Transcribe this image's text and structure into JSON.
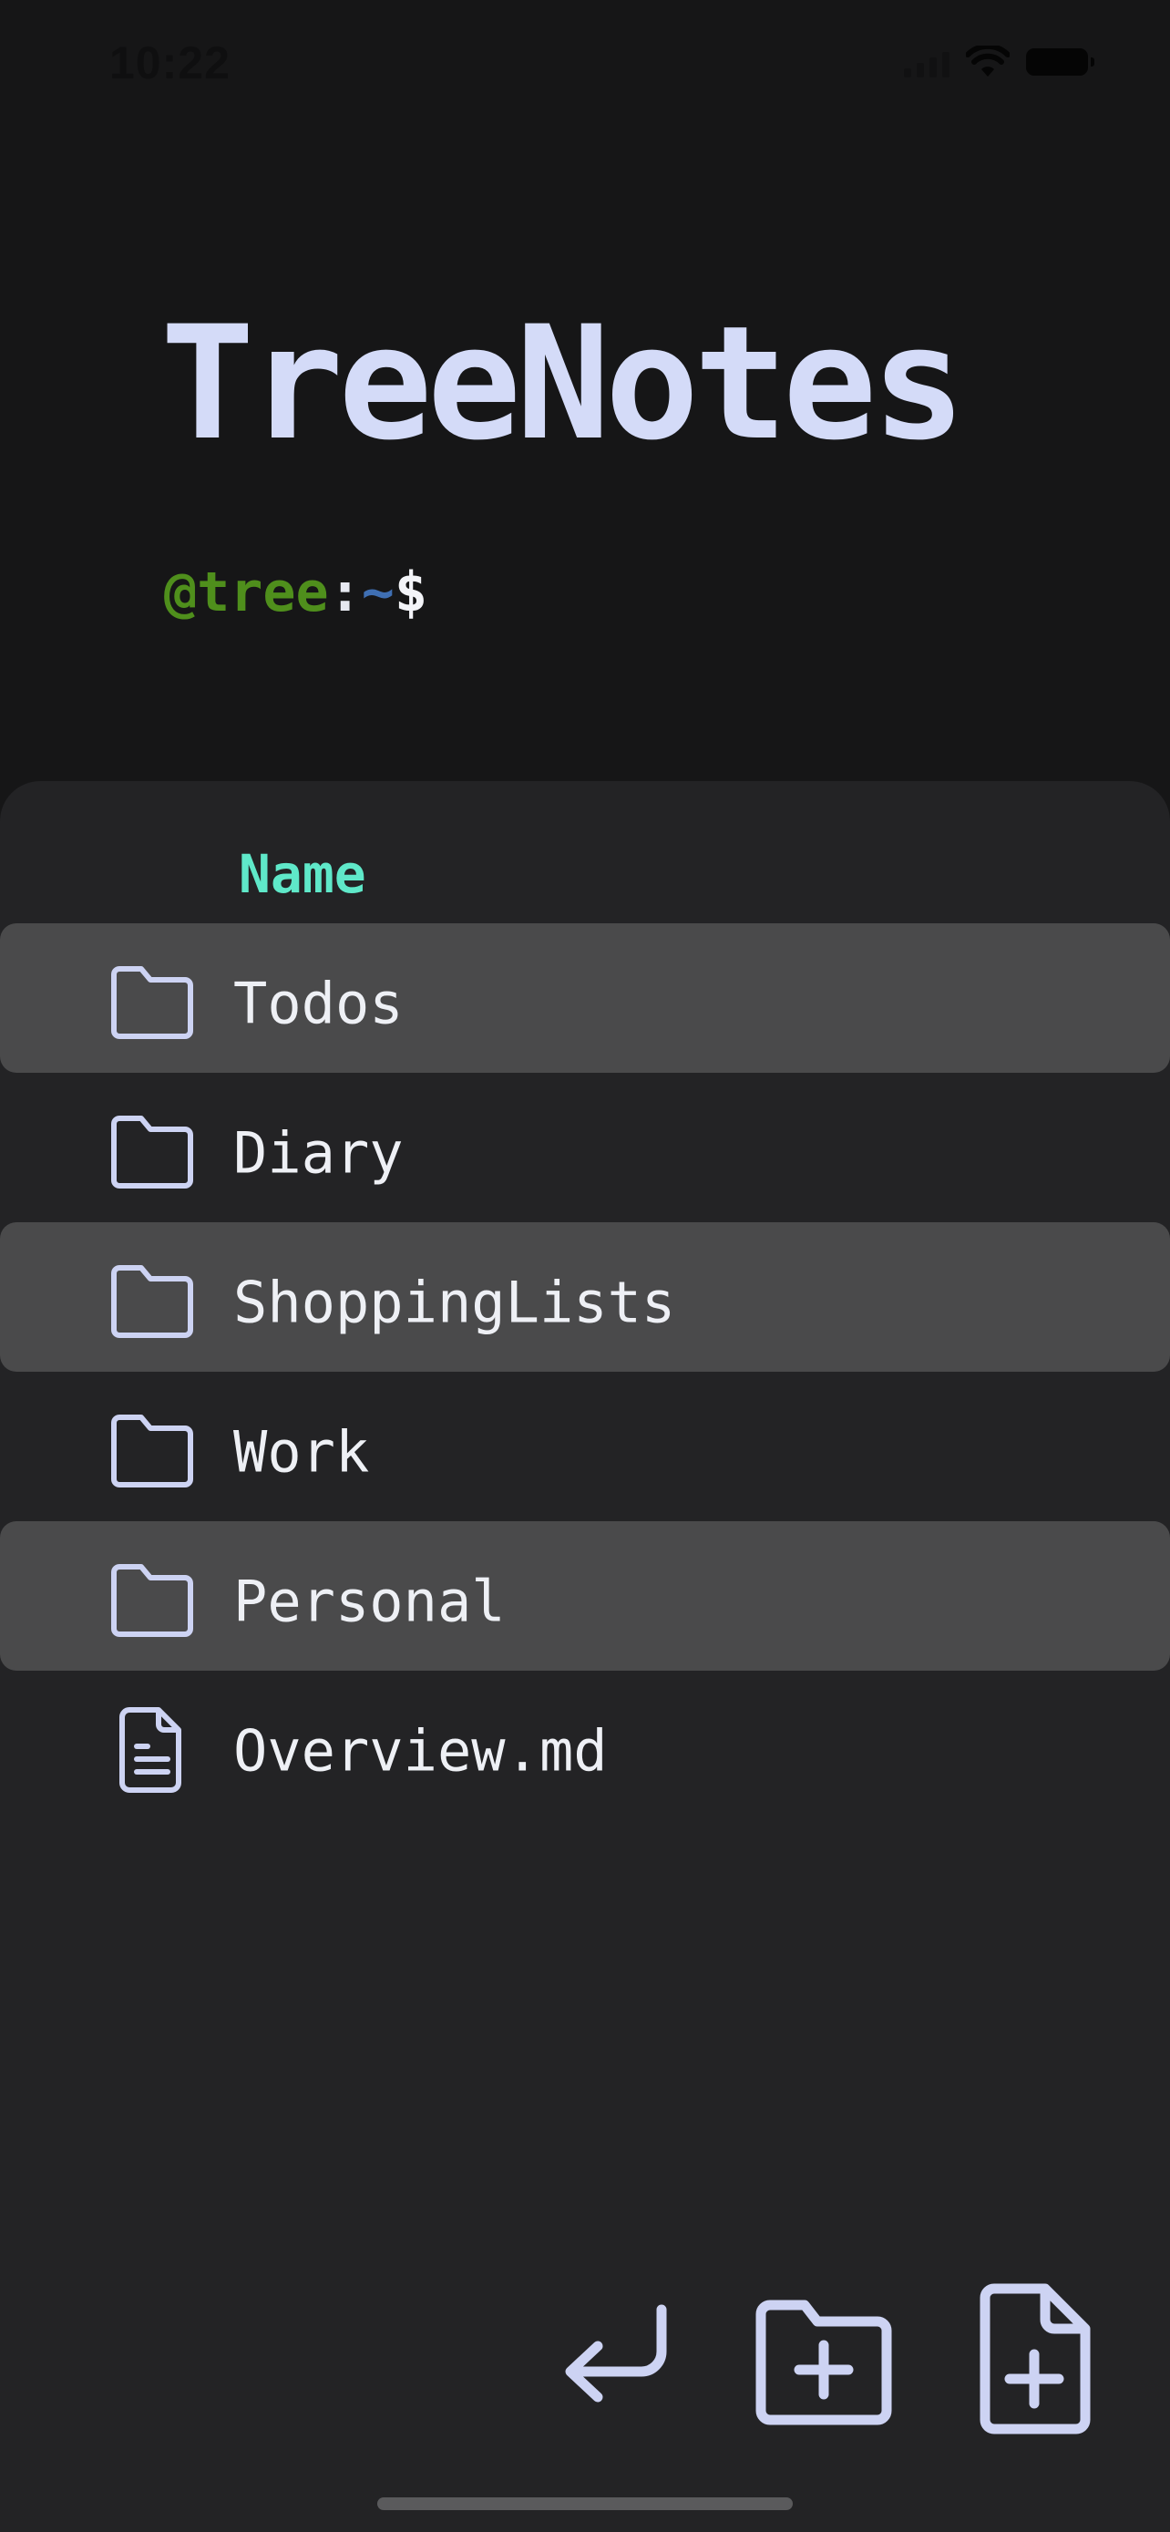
{
  "status_bar": {
    "time": "10:22"
  },
  "header": {
    "title": "TreeNotes",
    "prompt": {
      "user": "@tree",
      "colon": ":",
      "path": "~",
      "symbol": "$"
    }
  },
  "file_list": {
    "column_header": "Name",
    "items": [
      {
        "label": "Todos",
        "icon": "folder-icon",
        "type": "folder"
      },
      {
        "label": "Diary",
        "icon": "folder-icon",
        "type": "folder"
      },
      {
        "label": "ShoppingLists",
        "icon": "folder-icon",
        "type": "folder"
      },
      {
        "label": "Work",
        "icon": "folder-icon",
        "type": "folder"
      },
      {
        "label": "Personal",
        "icon": "folder-icon",
        "type": "folder"
      },
      {
        "label": "Overview.md",
        "icon": "document-icon",
        "type": "file"
      }
    ]
  },
  "toolbar": {
    "buttons": [
      {
        "icon": "return-arrow-icon",
        "action": "back"
      },
      {
        "icon": "folder-plus-icon",
        "action": "new-folder"
      },
      {
        "icon": "file-plus-icon",
        "action": "new-file"
      }
    ]
  },
  "colors": {
    "background": "#161617",
    "panel": "#232325",
    "row_stripe": "#4a4a4b",
    "title": "#d4dbf8",
    "accent_header": "#5fe8c9",
    "icon": "#cdd3f3",
    "prompt_user": "#4f8f1c",
    "prompt_path": "#3f6fb3"
  }
}
